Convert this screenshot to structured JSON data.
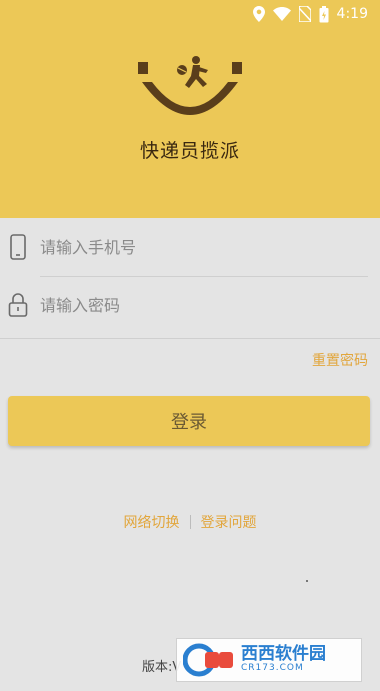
{
  "status_bar": {
    "time": "4:19",
    "icons": [
      "location-icon",
      "wifi-icon",
      "no-sim-icon",
      "battery-icon"
    ]
  },
  "app": {
    "name": "快递员揽派",
    "logo": "smiley-courier-logo"
  },
  "form": {
    "phone_placeholder": "请输入手机号",
    "password_placeholder": "请输入密码",
    "phone_icon": "phone-icon",
    "password_icon": "lock-icon"
  },
  "reset_password": "重置密码",
  "login_button": "登录",
  "links": {
    "network_switch": "网络切换",
    "login_issues": "登录问题"
  },
  "version_label": "版本:V",
  "watermark": {
    "title": "西西软件园",
    "subtitle": "CR173.COM"
  },
  "colors": {
    "primary": "#ecc857",
    "link": "#e2a63c",
    "background": "#e4e4e4",
    "logo_brown": "#5a3e1b"
  }
}
